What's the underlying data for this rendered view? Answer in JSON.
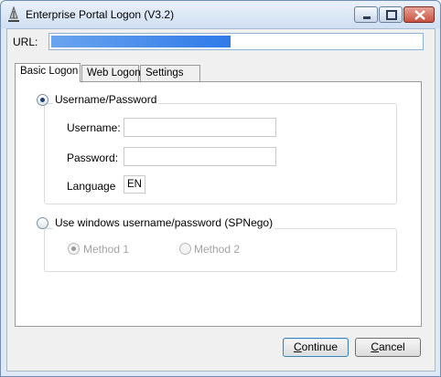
{
  "window": {
    "title": "Enterprise Portal Logon (V3.2)",
    "icon": "app-logo-icon"
  },
  "url": {
    "label": "URL:",
    "value": ""
  },
  "tabs": [
    {
      "label": "Basic Logon",
      "active": true
    },
    {
      "label": "Web Logon",
      "active": false
    },
    {
      "label": "Settings",
      "active": false
    }
  ],
  "basic_logon": {
    "option_userpass": {
      "label": "Username/Password",
      "checked": true
    },
    "username": {
      "label": "Username:",
      "value": ""
    },
    "password": {
      "label": "Password:",
      "value": ""
    },
    "language": {
      "label": "Language",
      "value": "EN"
    },
    "option_windows": {
      "label": "Use windows username/password (SPNego)",
      "checked": false
    },
    "method1": {
      "label": "Method 1",
      "checked": true,
      "enabled": false
    },
    "method2": {
      "label": "Method 2",
      "checked": false,
      "enabled": false
    }
  },
  "buttons": {
    "continue": {
      "label_first": "C",
      "label_rest": "ontinue"
    },
    "cancel": {
      "label_first": "C",
      "label_rest": "ancel"
    }
  },
  "colors": {
    "title_bar": "#cfdff2",
    "close_button": "#c75140",
    "url_mask": "#2f7ae8"
  }
}
